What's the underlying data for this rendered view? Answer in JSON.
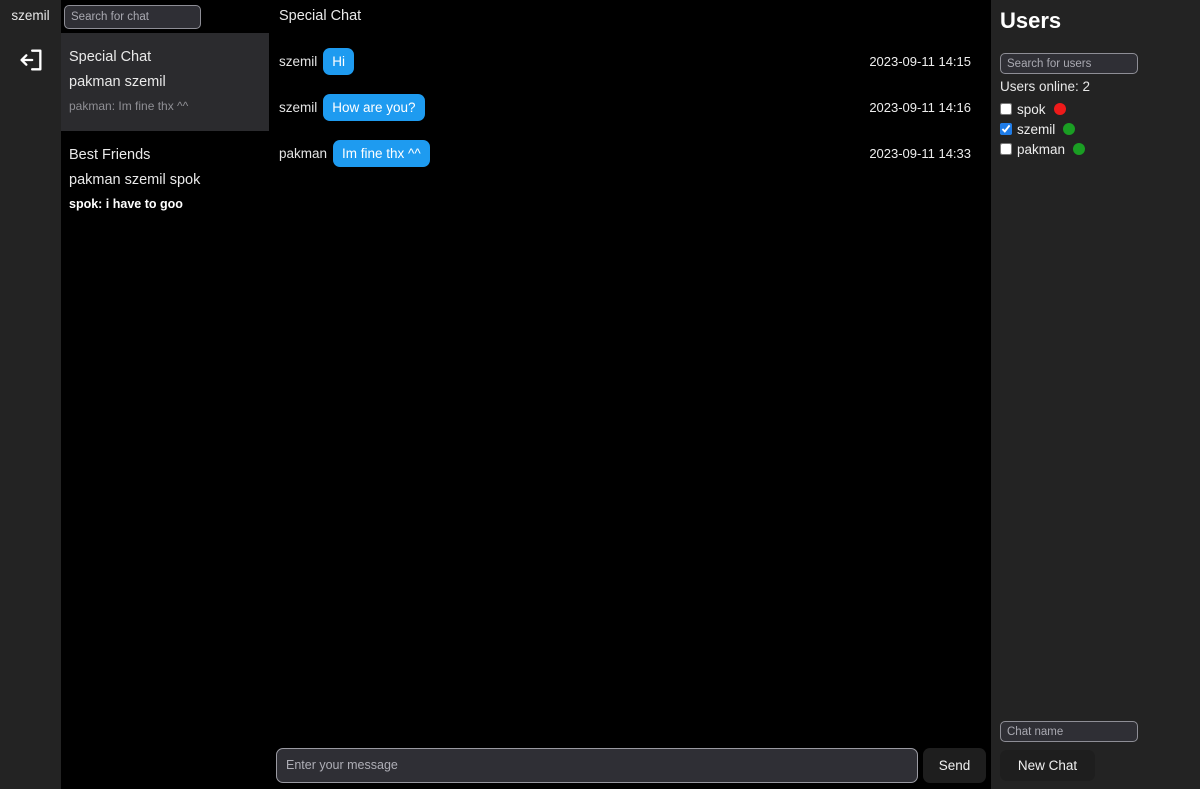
{
  "rail": {
    "username": "szemil",
    "logout_icon": "logout-icon"
  },
  "chat_sidebar": {
    "search": {
      "placeholder": "Search for chat",
      "value": ""
    },
    "items": [
      {
        "title": "Special Chat",
        "members": "pakman szemil",
        "preview": "pakman: Im fine thx ^^",
        "selected": true,
        "unread": false
      },
      {
        "title": "Best Friends",
        "members": "pakman szemil spok",
        "preview": "spok: i have to goo",
        "selected": false,
        "unread": true
      }
    ]
  },
  "main": {
    "header_title": "Special Chat",
    "messages": [
      {
        "author": "szemil",
        "text": "Hi",
        "time": "2023-09-11 14:15"
      },
      {
        "author": "szemil",
        "text": "How are you?",
        "time": "2023-09-11 14:16"
      },
      {
        "author": "pakman",
        "text": "Im fine thx ^^",
        "time": "2023-09-11 14:33"
      }
    ],
    "composer": {
      "placeholder": "Enter your message",
      "value": "",
      "send_label": "Send"
    }
  },
  "users_panel": {
    "title": "Users",
    "search": {
      "placeholder": "Search for users",
      "value": ""
    },
    "online_label": "Users online: 2",
    "users": [
      {
        "name": "spok",
        "checked": false,
        "status": "offline",
        "status_color": "#ee1a1a"
      },
      {
        "name": "szemil",
        "checked": true,
        "status": "online",
        "status_color": "#1a9e23"
      },
      {
        "name": "pakman",
        "checked": false,
        "status": "online",
        "status_color": "#1a9e23"
      }
    ],
    "new_chat": {
      "placeholder": "Chat name",
      "value": "",
      "button_label": "New Chat"
    }
  },
  "colors": {
    "bubble_blue": "#1e9bf0",
    "panel_gray": "#232323",
    "selected_gray": "#2b2b2e",
    "background_black": "#000000"
  }
}
